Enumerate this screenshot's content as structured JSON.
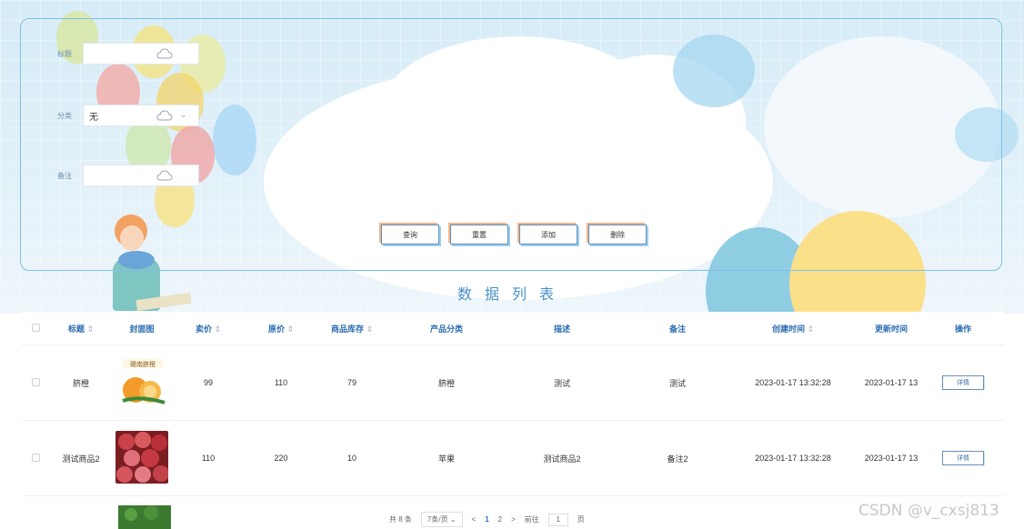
{
  "search": {
    "title_label": "标题",
    "category_label": "分类",
    "category_value": "无",
    "remark_label": "备注"
  },
  "buttons": {
    "query": "查询",
    "reset": "重置",
    "add": "添加",
    "delete": "删除"
  },
  "list_title": "数据列表",
  "table": {
    "headers": {
      "title": "标题",
      "cover": "封面图",
      "price": "卖价",
      "original_price": "原价",
      "stock": "商品库存",
      "category": "产品分类",
      "description": "描述",
      "remark": "备注",
      "created": "创建时间",
      "updated": "更新时间",
      "action": "操作"
    },
    "sort_icon": "⇕",
    "rows": [
      {
        "title": "脐橙",
        "price": "99",
        "original_price": "110",
        "stock": "79",
        "category": "脐橙",
        "description": "测试",
        "remark": "测试",
        "created": "2023-01-17 13:32:28",
        "updated": "2023-01-17 13",
        "action": "详情",
        "cover_color": "#f2a23a"
      },
      {
        "title": "测试商品2",
        "price": "110",
        "original_price": "220",
        "stock": "10",
        "category": "苹果",
        "description": "测试商品2",
        "remark": "备注2",
        "created": "2023-01-17 13:32:28",
        "updated": "2023-01-17 13",
        "action": "详情",
        "cover_color": "#b8303a"
      }
    ]
  },
  "pagination": {
    "total": "共 8 条",
    "page_size": "7条/页",
    "prev": "<",
    "page1": "1",
    "page2": "2",
    "next": ">",
    "goto_label": "前往",
    "goto_value": "1",
    "page_suffix": "页"
  },
  "watermark": "CSDN @v_cxsj813",
  "colors": {
    "accent": "#4a90c9",
    "panel_border": "#7ec1e6",
    "header_text": "#2b6cb0"
  }
}
